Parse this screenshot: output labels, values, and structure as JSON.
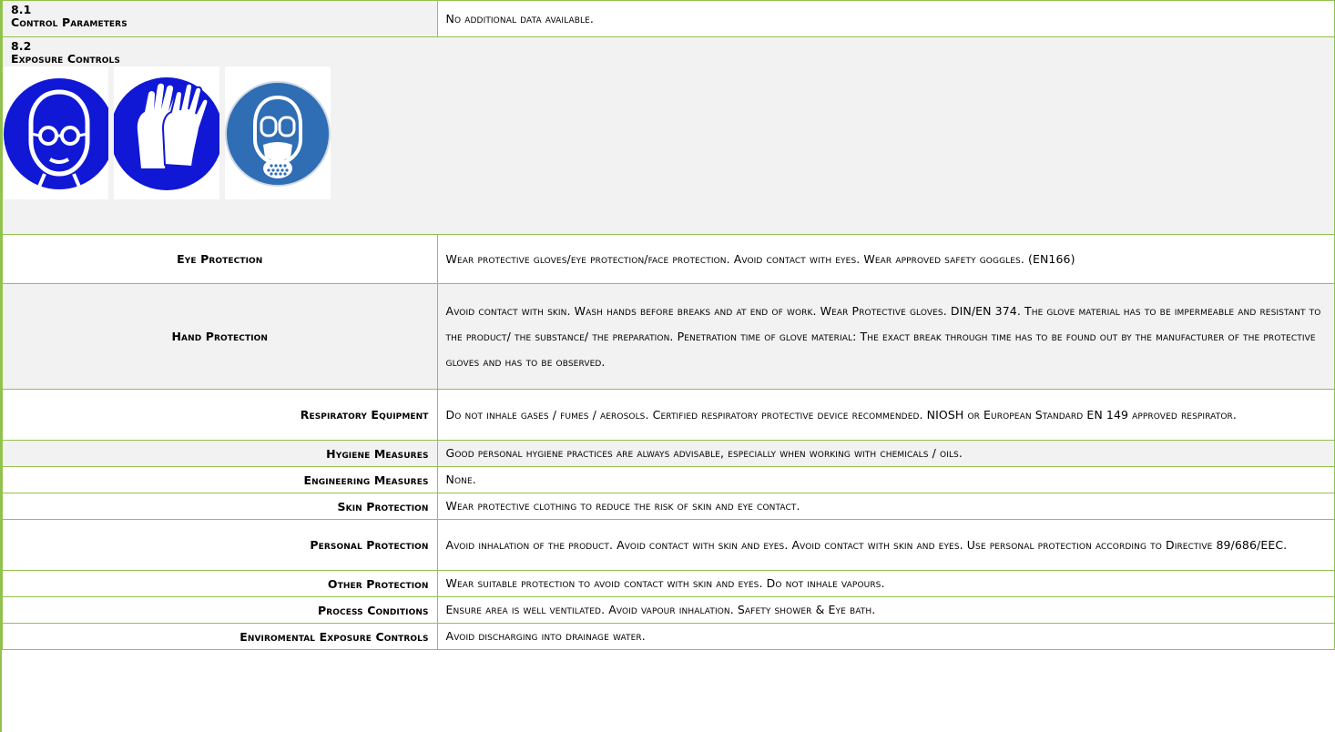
{
  "section_8_1": {
    "number": "8.1",
    "title": "Control Parameters",
    "value": "No additional data  available."
  },
  "section_8_2": {
    "number": "8.2",
    "title": "Exposure Controls",
    "icons": [
      "goggles-icon",
      "gloves-icon",
      "respirator-icon"
    ],
    "colors": {
      "icon_blue": "#1018d6",
      "icon_blue_alt": "#2f6db5",
      "border_green": "#92c24d",
      "row_gray": "#f2f2f2"
    }
  },
  "rows": [
    {
      "label": "Eye Protection",
      "value": "Wear protective gloves/eye protection/face protection.  Avoid contact with eyes. Wear approved safety goggles. (EN166)"
    },
    {
      "label": "Hand Protection",
      "value": "Avoid contact with skin. Wash hands before breaks and at end of work. Wear Protective gloves. DIN/EN 374.  The glove material has to be impermeable and resistant to the product/ the substance/ the preparation. Penetration time of glove material: The exact break through time has to be found out by the manufacturer of the protective gloves and has to be observed."
    },
    {
      "label": "Respiratory Equipment",
      "value": "Do not inhale gases / fumes / aerosols. Certified respiratory protective device recommended.  NIOSH or European Standard EN 149 approved respirator."
    },
    {
      "label": "Hygiene Measures",
      "value": "Good personal hygiene practices are always advisable, especially when working with chemicals / oils."
    },
    {
      "label": "Engineering Measures",
      "value": "None."
    },
    {
      "label": "Skin Protection",
      "value": "Wear protective clothing to reduce the risk of skin and eye contact."
    },
    {
      "label": "Personal Protection",
      "value": "Avoid inhalation of the product. Avoid contact with skin and eyes. Avoid contact with skin and eyes. Use personal protection according to Directive 89/686/EEC."
    },
    {
      "label": "Other Protection",
      "value": "Wear suitable protection to avoid contact with skin and eyes. Do not inhale vapours."
    },
    {
      "label": "Process Conditions",
      "value": "Ensure area is well ventilated. Avoid vapour inhalation. Safety shower & Eye bath."
    },
    {
      "label": "Enviromental Exposure Controls",
      "value": "Avoid discharging into drainage water."
    }
  ]
}
